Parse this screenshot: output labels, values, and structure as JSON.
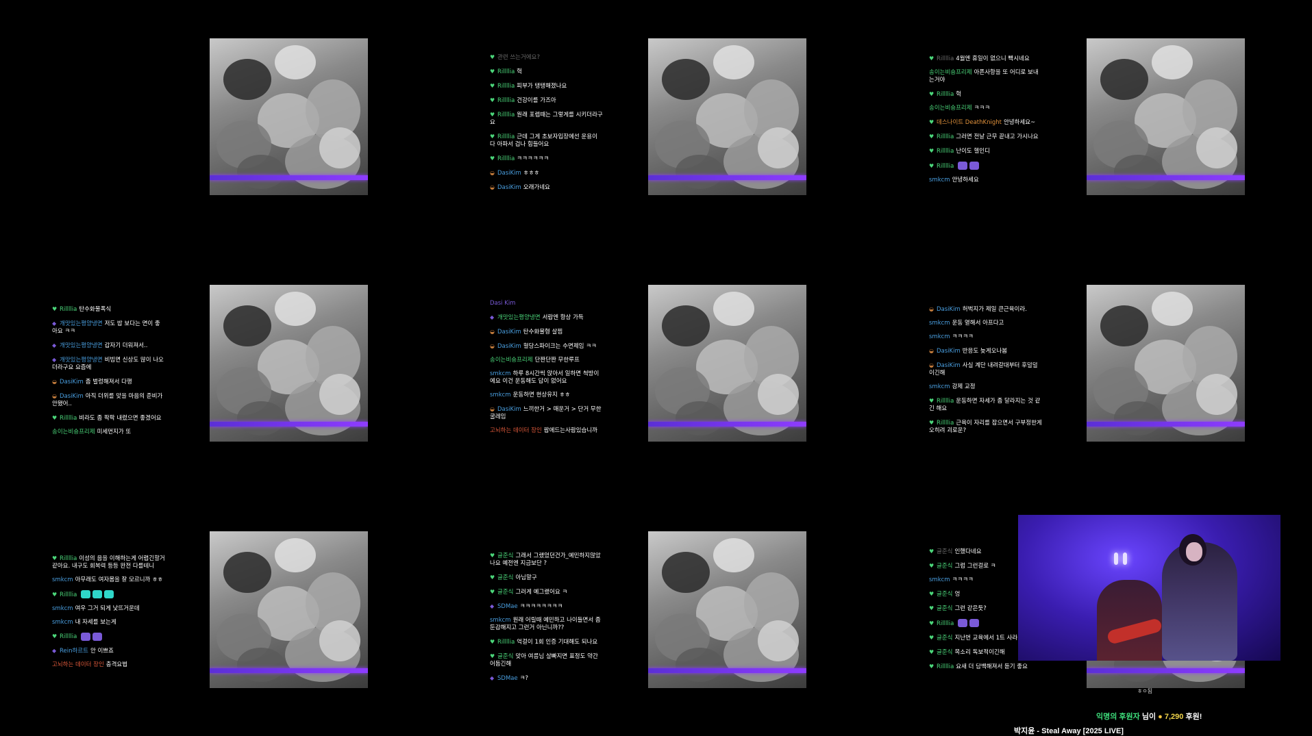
{
  "colors": {
    "background": "#000000",
    "accent": "#8e3cff",
    "donor_name": "#3ee07c",
    "donation_amount": "#f2d64b"
  },
  "chat_panels": [
    {
      "messages": []
    },
    {
      "messages": [
        {
          "icon": "heart-icon",
          "user": "관련 쓰는거에요?",
          "user_color": "#6a6a6a",
          "text": ""
        },
        {
          "icon": "heart-icon",
          "user": "Rillllia",
          "user_color": "#4bd67a",
          "text": "헉"
        },
        {
          "icon": "heart-icon",
          "user": "Rillllia",
          "user_color": "#4bd67a",
          "text": "피부가 탱탱해졌나요"
        },
        {
          "icon": "heart-icon",
          "user": "Rillllia",
          "user_color": "#4bd67a",
          "text": "건강이를 가즈아"
        },
        {
          "icon": "heart-icon",
          "user": "Rillllia",
          "user_color": "#4bd67a",
          "text": "원래 포렙때는 그렇게를 시키더라구요"
        },
        {
          "icon": "heart-icon",
          "user": "Rillllia",
          "user_color": "#4bd67a",
          "text": "근데 그게 초보자입장에선 운용이 다 아파서 겁나 힘들어요"
        },
        {
          "icon": "heart-icon",
          "user": "Rillllia",
          "user_color": "#4bd67a",
          "text": "ㅋㅋㅋㅋㅋㅋ"
        },
        {
          "icon": "hat-icon",
          "user": "DasiKim",
          "user_color": "#4a9fe0",
          "text": "ㅎㅎㅎ"
        },
        {
          "icon": "hat-icon",
          "user": "DasiKim",
          "user_color": "#4a9fe0",
          "text": "오래가네요"
        }
      ]
    },
    {
      "messages": [
        {
          "icon": "heart-icon",
          "user": "Rillllia",
          "user_color": "#6a6a6a",
          "text": "4월엔 휴일이 없으니 빡시네요"
        },
        {
          "icon": "",
          "user": "송이는비숑프리제",
          "user_color": "#4bd67a",
          "text": "아픈사항을 또 어디로 보내는거야"
        },
        {
          "icon": "heart-icon",
          "user": "Rillllia",
          "user_color": "#4bd67a",
          "text": "헉"
        },
        {
          "icon": "",
          "user": "송이는비숑프리제",
          "user_color": "#4bd67a",
          "text": "ㅋㅋㅋ"
        },
        {
          "icon": "heart-icon",
          "user": "데스나이트 DeathKnight",
          "user_color": "#e0913b",
          "text": "안녕하세요~"
        },
        {
          "icon": "heart-icon",
          "user": "Rillllia",
          "user_color": "#4bd67a",
          "text": "그러면 전날 근무 끝내고 가시나요"
        },
        {
          "icon": "heart-icon",
          "user": "Rillllia",
          "user_color": "#4bd67a",
          "text": "난이도 헬인디"
        },
        {
          "icon": "heart-icon",
          "user": "Rillllia",
          "user_color": "#4bd67a",
          "text": "",
          "emotes": [
            "purple",
            "purple"
          ]
        },
        {
          "icon": "",
          "user": "smkcm",
          "user_color": "#4a9fe0",
          "text": "안녕하세요"
        }
      ]
    },
    {
      "messages": [
        {
          "icon": "heart-icon",
          "user": "Rillllia",
          "user_color": "#4bd67a",
          "text": "탄수화물폭식"
        },
        {
          "icon": "shield-icon",
          "user": "개맛있는평양냉면",
          "user_color": "#4a9fe0",
          "text": "저도 밥 보다는 면이 좋아요 ㅋㅋ"
        },
        {
          "icon": "shield-icon",
          "user": "개맛있는평양냉면",
          "user_color": "#4a9fe0",
          "text": "갑자기 더워져서.."
        },
        {
          "icon": "shield-icon",
          "user": "개맛있는평양냉면",
          "user_color": "#4a9fe0",
          "text": "비빔면 신상도 많이 나오더라구요 요즘에"
        },
        {
          "icon": "hat-icon",
          "user": "DasiKim",
          "user_color": "#4a9fe0",
          "text": "좀 벌렁해져서 다행"
        },
        {
          "icon": "hat-icon",
          "user": "DasiKim",
          "user_color": "#4a9fe0",
          "text": "아직 더위를 맞을 마음의 준비가 안됐어.."
        },
        {
          "icon": "heart-icon",
          "user": "Rillllia",
          "user_color": "#4bd67a",
          "text": "비라도 좀 팍팍 내렸으면 좋겠어요"
        },
        {
          "icon": "",
          "user": "송이는비숑프리제",
          "user_color": "#4bd67a",
          "text": "미세먼지가 또"
        }
      ]
    },
    {
      "messages": [
        {
          "icon": "",
          "user": "Dasi Kim",
          "user_color": "#7a5ad8",
          "text": ""
        },
        {
          "icon": "shield-icon",
          "user": "개맛있는평양냉면",
          "user_color": "#4bd67a",
          "text": "서랍엔 항상 가득"
        },
        {
          "icon": "hat-icon",
          "user": "DasiKim",
          "user_color": "#4a9fe0",
          "text": "탄수화물형 살찜"
        },
        {
          "icon": "hat-icon",
          "user": "DasiKim",
          "user_color": "#4a9fe0",
          "text": "혈당스파이크는 수면제임 ㅋㅋ"
        },
        {
          "icon": "",
          "user": "송이는비숑프리제",
          "user_color": "#4bd67a",
          "text": "단짠단짠 무한루프"
        },
        {
          "icon": "",
          "user": "smkcm",
          "user_color": "#4a9fe0",
          "text": "하루 8시간씩 앉아서 일하면 척방이에요 이건 운동해도 답이 없어요"
        },
        {
          "icon": "",
          "user": "smkcm",
          "user_color": "#4a9fe0",
          "text": "운동하면 현상유지 ㅎㅎ"
        },
        {
          "icon": "hat-icon",
          "user": "DasiKim",
          "user_color": "#4a9fe0",
          "text": "느끼한거 > 매운거 > 단거 무한굴레임"
        },
        {
          "icon": "",
          "user": "고뇌하는 데이터 장인",
          "user_color": "#e05a3b",
          "text": "팝에드는사람있습니까"
        }
      ]
    },
    {
      "messages": [
        {
          "icon": "hat-icon",
          "user": "DasiKim",
          "user_color": "#4a9fe0",
          "text": "허벅지가 제일 큰근육이라."
        },
        {
          "icon": "",
          "user": "smkcm",
          "user_color": "#4a9fe0",
          "text": "운동 열해서 아프다고"
        },
        {
          "icon": "",
          "user": "smkcm",
          "user_color": "#4a9fe0",
          "text": "ㅋㅋㅋㅋ"
        },
        {
          "icon": "hat-icon",
          "user": "DasiKim",
          "user_color": "#4a9fe0",
          "text": "반응도 늦게오나봄"
        },
        {
          "icon": "hat-icon",
          "user": "DasiKim",
          "user_color": "#4a9fe0",
          "text": "사실 계단 내려갈대부터 후덜덜이긴해"
        },
        {
          "icon": "",
          "user": "smkcm",
          "user_color": "#4a9fe0",
          "text": "강제 교정"
        },
        {
          "icon": "heart-icon",
          "user": "Rillllia",
          "user_color": "#4bd67a",
          "text": "운동하면 자세가 좀 달라지는 것 같긴 해요"
        },
        {
          "icon": "heart-icon",
          "user": "Rillllia",
          "user_color": "#4bd67a",
          "text": "근육이 자리를 잡으면서 구부정한게 오히려 괴로운?"
        }
      ]
    },
    {
      "messages": [
        {
          "icon": "heart-icon",
          "user": "Rillllia",
          "user_color": "#4bd67a",
          "text": "이성의 음을 이해하는게 어렵긴할거 같아요. 내구도 회복력 등등 완전 다를테니"
        },
        {
          "icon": "",
          "user": "smkcm",
          "user_color": "#4a9fe0",
          "text": "아무래도 여자몸을 잘 모르니까 ㅎㅎ"
        },
        {
          "icon": "heart-icon",
          "user": "Rillllia",
          "user_color": "#4bd67a",
          "text": "",
          "emotes": [
            "teal",
            "teal",
            "teal"
          ]
        },
        {
          "icon": "",
          "user": "smkcm",
          "user_color": "#4a9fe0",
          "text": "여우 그거 되게 낯뜨거운데"
        },
        {
          "icon": "",
          "user": "smkcm",
          "user_color": "#4a9fe0",
          "text": "내 자세를 보는게"
        },
        {
          "icon": "heart-icon",
          "user": "Rillllia",
          "user_color": "#4bd67a",
          "text": "",
          "emotes": [
            "purple",
            "purple"
          ]
        },
        {
          "icon": "shield-icon",
          "user": "Rein하르트",
          "user_color": "#4a9fe0",
          "text": "안 이쁘죠"
        },
        {
          "icon": "",
          "user": "고뇌하는 데이터 장인",
          "user_color": "#e05a3b",
          "text": "충격요법"
        }
      ]
    },
    {
      "messages": [
        {
          "icon": "heart-icon",
          "user": "글준식",
          "user_color": "#4bd67a",
          "text": "그래서 그랬었던건가_예민하지않았나요 예전엔 지금보단 ?"
        },
        {
          "icon": "heart-icon",
          "user": "글준식",
          "user_color": "#4bd67a",
          "text": "아님말구"
        },
        {
          "icon": "heart-icon",
          "user": "글준식",
          "user_color": "#4bd67a",
          "text": "그러게 예그랬어요 ㅋ"
        },
        {
          "icon": "shield-icon",
          "user": "SDMae",
          "user_color": "#4a9fe0",
          "text": "ㅋㅋㅋㅋㅋㅋㅋㅋ"
        },
        {
          "icon": "",
          "user": "smkcm",
          "user_color": "#4a9fe0",
          "text": "원래 어릴때 예민하고 나이들면서 좀 둔감해지고 그런거 아닌니까??"
        },
        {
          "icon": "heart-icon",
          "user": "Rillllia",
          "user_color": "#4bd67a",
          "text": "억걸이 1회 인증 기대해도 되나요"
        },
        {
          "icon": "heart-icon",
          "user": "글준식",
          "user_color": "#4bd67a",
          "text": "맞아 여름님 살빠지면 표정도 약간 어둡긴해"
        },
        {
          "icon": "shield-icon",
          "user": "SDMae",
          "user_color": "#4a9fe0",
          "text": "ㅋ?"
        }
      ]
    },
    {
      "messages": [
        {
          "icon": "heart-icon",
          "user": "글준식",
          "user_color": "#6a6a6a",
          "text": "인했다네요"
        },
        {
          "icon": "heart-icon",
          "user": "글준식",
          "user_color": "#4bd67a",
          "text": "그럼 그런걸로 ㅋ"
        },
        {
          "icon": "",
          "user": "smkcm",
          "user_color": "#4a9fe0",
          "text": "ㅋㅋㅋㅋ"
        },
        {
          "icon": "heart-icon",
          "user": "글준식",
          "user_color": "#4bd67a",
          "text": "엉"
        },
        {
          "icon": "heart-icon",
          "user": "글준식",
          "user_color": "#4bd67a",
          "text": "그런 같은듯?"
        },
        {
          "icon": "heart-icon",
          "user": "Rillllia",
          "user_color": "#4bd67a",
          "text": "",
          "emotes": [
            "purple",
            "purple"
          ]
        },
        {
          "icon": "heart-icon",
          "user": "글준식",
          "user_color": "#4bd67a",
          "text": "지난번 교육에서 1트 사라"
        },
        {
          "icon": "heart-icon",
          "user": "글준식",
          "user_color": "#4bd67a",
          "text": "목소리 독보적이긴해"
        },
        {
          "icon": "heart-icon",
          "user": "Rillllia",
          "user_color": "#4bd67a",
          "text": "요새 더 담백해져서 듣기 좋요"
        }
      ]
    }
  ],
  "overlay": {
    "subtitle": "ㅎㅇ됨",
    "donation": {
      "donor": "익명의 후원자",
      "suffix": "님이",
      "coin_icon": "coin-icon",
      "amount": "7,290",
      "after": "후원!"
    },
    "now_playing": "박지윤 - Steal Away [2025 LIVE]"
  }
}
